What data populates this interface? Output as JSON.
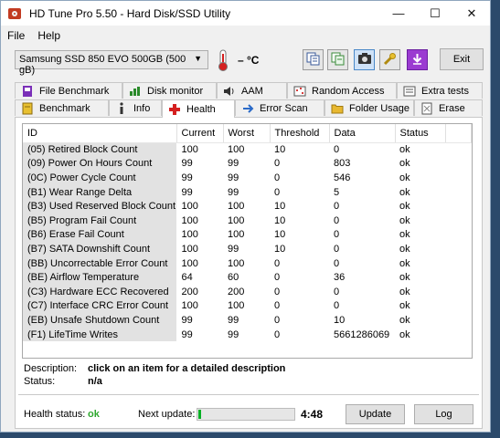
{
  "window": {
    "title": "HD Tune Pro 5.50 - Hard Disk/SSD Utility"
  },
  "menu": [
    "File",
    "Help"
  ],
  "toolbar": {
    "drive": "Samsung SSD 850 EVO 500GB (500 gB)",
    "temperature": "– °C",
    "exit_label": "Exit"
  },
  "tabs_top": [
    "File Benchmark",
    "Disk monitor",
    "AAM",
    "Random Access",
    "Extra tests"
  ],
  "tabs_bottom": [
    "Benchmark",
    "Info",
    "Health",
    "Error Scan",
    "Folder Usage",
    "Erase"
  ],
  "active_tab": "Health",
  "table": {
    "headers": [
      "ID",
      "Current",
      "Worst",
      "Threshold",
      "Data",
      "Status"
    ],
    "rows": [
      [
        "(05) Retired Block Count",
        "100",
        "100",
        "10",
        "0",
        "ok"
      ],
      [
        "(09) Power On Hours Count",
        "99",
        "99",
        "0",
        "803",
        "ok"
      ],
      [
        "(0C) Power Cycle Count",
        "99",
        "99",
        "0",
        "546",
        "ok"
      ],
      [
        "(B1) Wear Range Delta",
        "99",
        "99",
        "0",
        "5",
        "ok"
      ],
      [
        "(B3) Used Reserved Block Count",
        "100",
        "100",
        "10",
        "0",
        "ok"
      ],
      [
        "(B5) Program Fail Count",
        "100",
        "100",
        "10",
        "0",
        "ok"
      ],
      [
        "(B6) Erase Fail Count",
        "100",
        "100",
        "10",
        "0",
        "ok"
      ],
      [
        "(B7) SATA Downshift Count",
        "100",
        "99",
        "10",
        "0",
        "ok"
      ],
      [
        "(BB) Uncorrectable Error Count",
        "100",
        "100",
        "0",
        "0",
        "ok"
      ],
      [
        "(BE) Airflow Temperature",
        "64",
        "60",
        "0",
        "36",
        "ok"
      ],
      [
        "(C3) Hardware ECC Recovered",
        "200",
        "200",
        "0",
        "0",
        "ok"
      ],
      [
        "(C7) Interface CRC Error Count",
        "100",
        "100",
        "0",
        "0",
        "ok"
      ],
      [
        "(EB) Unsafe Shutdown Count",
        "99",
        "99",
        "0",
        "10",
        "ok"
      ],
      [
        "(F1) LifeTime Writes",
        "99",
        "99",
        "0",
        "5661286069",
        "ok"
      ]
    ]
  },
  "description": {
    "label": "Description:",
    "value": "click on an item for a detailed description",
    "status_label": "Status:",
    "status_value": "n/a"
  },
  "footer": {
    "health_label": "Health status:",
    "health_value": "ok",
    "next_update_label": "Next update:",
    "progress_fraction": 0.03,
    "countdown": "4:48",
    "update_label": "Update",
    "log_label": "Log"
  },
  "colors": {
    "health_ok": "#2ea82e",
    "progress_fill": "#06b025"
  }
}
